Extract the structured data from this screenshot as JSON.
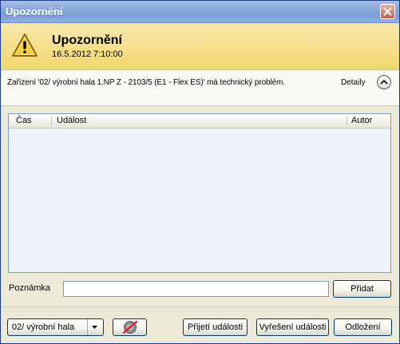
{
  "window": {
    "title": "Upozornění"
  },
  "header": {
    "title": "Upozornění",
    "datetime": "16.5.2012 7:10:00",
    "icon": "warning-icon"
  },
  "info": {
    "message": "Zařízení '02/ výrobní hala 1.NP Z - 2103/5 (E1 - Flex ES)' má technický problém.",
    "details_label": "Detaily"
  },
  "grid": {
    "columns": [
      "Čas",
      "Událost",
      "Autor"
    ],
    "rows": []
  },
  "note": {
    "label": "Poznámka",
    "value": "",
    "add_button": "Přidat"
  },
  "footer": {
    "location_button": "02/ výrobní hala",
    "accept_button": "Přijetí události",
    "resolve_button": "Vyřešení události",
    "postpone_button": "Odložení"
  }
}
